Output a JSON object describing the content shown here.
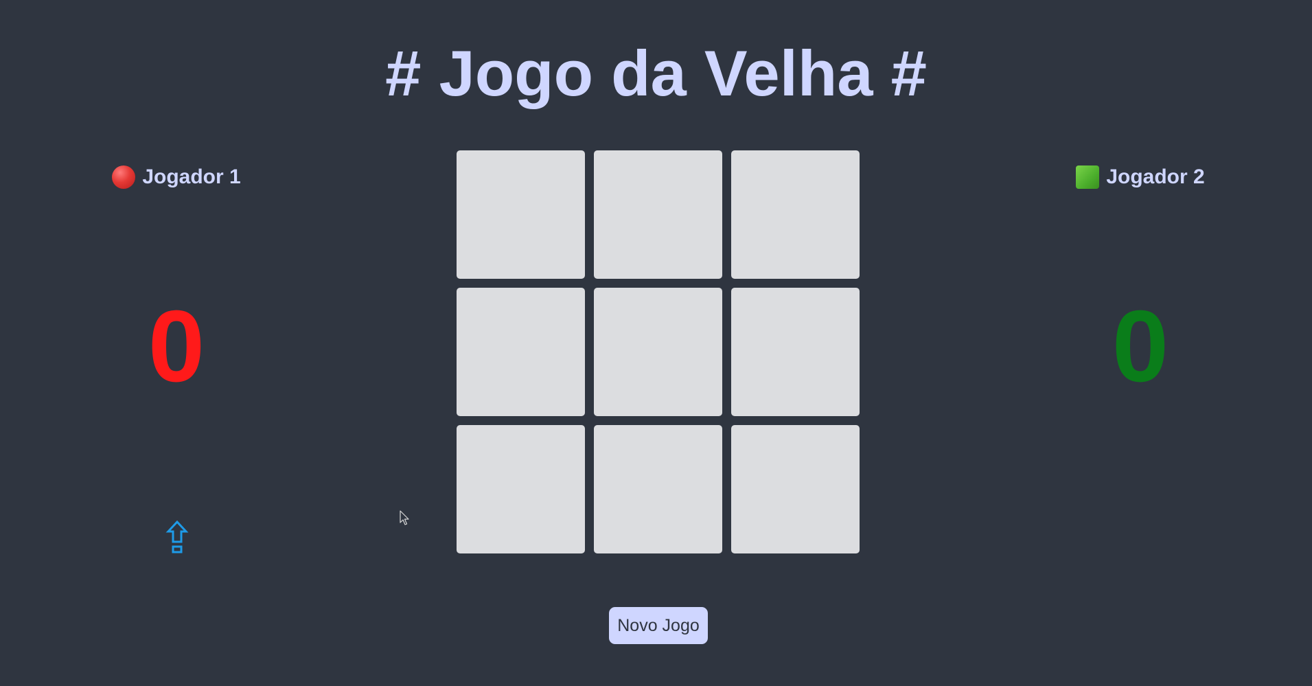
{
  "game": {
    "title": "# Jogo da Velha #"
  },
  "players": [
    {
      "name": "Jogador 1",
      "token_icon": "red-circle-icon",
      "score": "0",
      "score_color": "#ff1a1a"
    },
    {
      "name": "Jogador 2",
      "token_icon": "green-square-icon",
      "score": "0",
      "score_color": "#0a7d1a"
    }
  ],
  "turn": {
    "current_player": "Jogador 1",
    "indicator_icon": "up-arrow-icon",
    "indicator_color": "#1e9be8"
  },
  "board": {
    "cells": [
      "",
      "",
      "",
      "",
      "",
      "",
      "",
      "",
      ""
    ]
  },
  "controls": {
    "new_game_label": "Novo Jogo"
  },
  "colors": {
    "background": "#2f3540",
    "accent": "#cfd6ff",
    "cell": "#dcdde0"
  }
}
